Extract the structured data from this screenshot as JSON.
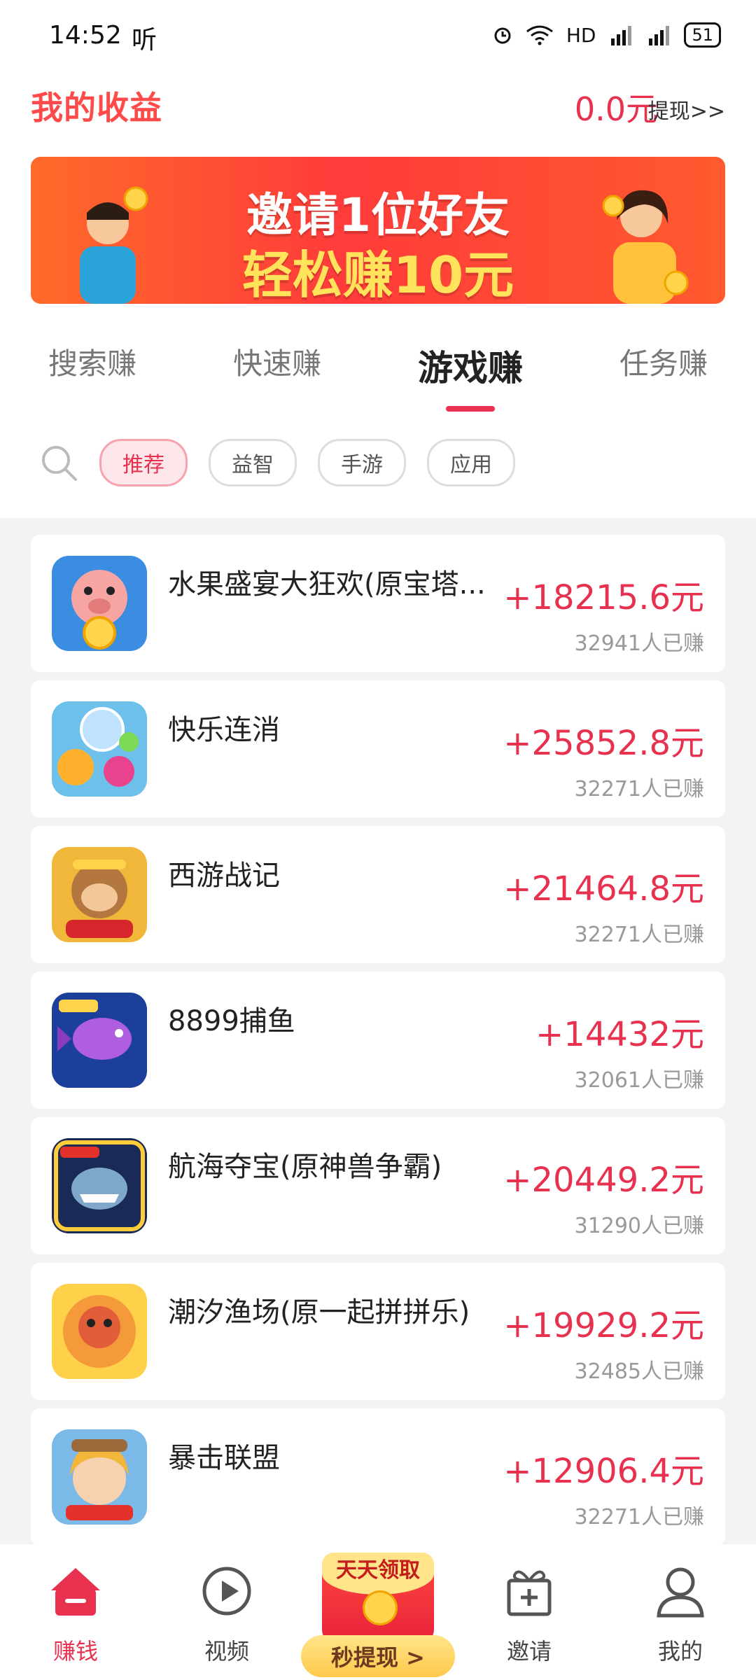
{
  "status": {
    "time": "14:52",
    "carrier_icon": "听",
    "network": "HD",
    "battery": "51"
  },
  "header": {
    "title": "我的收益",
    "balance": "0.0元",
    "withdraw": "提现>>"
  },
  "banner": {
    "line1": "邀请1位好友",
    "line2": "轻松赚10元"
  },
  "tabs": [
    {
      "label": "搜索赚"
    },
    {
      "label": "快速赚"
    },
    {
      "label": "游戏赚",
      "active": true
    },
    {
      "label": "任务赚"
    }
  ],
  "filters": [
    {
      "label": "推荐",
      "active": true
    },
    {
      "label": "益智"
    },
    {
      "label": "手游"
    },
    {
      "label": "应用"
    }
  ],
  "games": [
    {
      "name": "水果盛宴大狂欢(原宝塔...",
      "reward": "+18215.6元",
      "people": "32941人已赚",
      "icon": "pig-coin-icon"
    },
    {
      "name": "快乐连消",
      "reward": "+25852.8元",
      "people": "32271人已赚",
      "icon": "candy-icon"
    },
    {
      "name": "西游战记",
      "reward": "+21464.8元",
      "people": "32271人已赚",
      "icon": "monkey-king-icon"
    },
    {
      "name": "8899捕鱼",
      "reward": "+14432元",
      "people": "32061人已赚",
      "icon": "fish-icon"
    },
    {
      "name": "航海夺宝(原神兽争霸)",
      "reward": "+20449.2元",
      "people": "31290人已赚",
      "icon": "shark-icon"
    },
    {
      "name": "潮汐渔场(原一起拼拼乐)",
      "reward": "+19929.2元",
      "people": "32485人已赚",
      "icon": "octopus-icon"
    },
    {
      "name": "暴击联盟",
      "reward": "+12906.4元",
      "people": "32271人已赚",
      "icon": "girl-hero-icon"
    }
  ],
  "nav": [
    {
      "label": "赚钱",
      "icon": "home-earn-icon",
      "active": true
    },
    {
      "label": "视频",
      "icon": "play-icon"
    },
    {
      "label": "邀请",
      "icon": "gift-icon"
    },
    {
      "label": "我的",
      "icon": "profile-icon"
    }
  ],
  "cta": {
    "top": "天天领取",
    "label": "秒提现 >"
  },
  "colors": {
    "accent": "#e8304f",
    "title": "#ff4a4a"
  }
}
